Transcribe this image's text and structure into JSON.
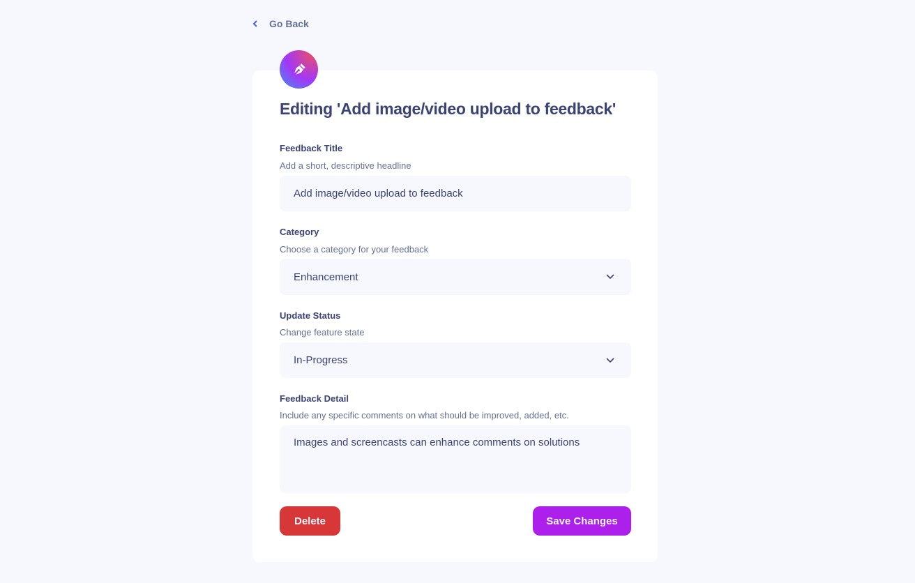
{
  "nav": {
    "back_label": "Go Back",
    "back_icon": "chevron-left-icon"
  },
  "header": {
    "badge_icon": "pen-nib-icon",
    "title": "Editing 'Add image/video upload to feedback'"
  },
  "form": {
    "title_field": {
      "label": "Feedback Title",
      "hint": "Add a short, descriptive headline",
      "value": "Add image/video upload to feedback"
    },
    "category_field": {
      "label": "Category",
      "hint": "Choose a category for your feedback",
      "value": "Enhancement"
    },
    "status_field": {
      "label": "Update Status",
      "hint": "Change feature state",
      "value": "In-Progress"
    },
    "detail_field": {
      "label": "Feedback Detail",
      "hint": "Include any specific comments on what should be improved, added, etc.",
      "value": "Images and screencasts can enhance comments on solutions"
    }
  },
  "actions": {
    "delete_label": "Delete",
    "save_label": "Save Changes"
  },
  "colors": {
    "background": "#f7f8fd",
    "card": "#ffffff",
    "text_primary": "#3a4374",
    "text_secondary": "#647196",
    "delete": "#d73737",
    "save": "#ad1fea"
  }
}
